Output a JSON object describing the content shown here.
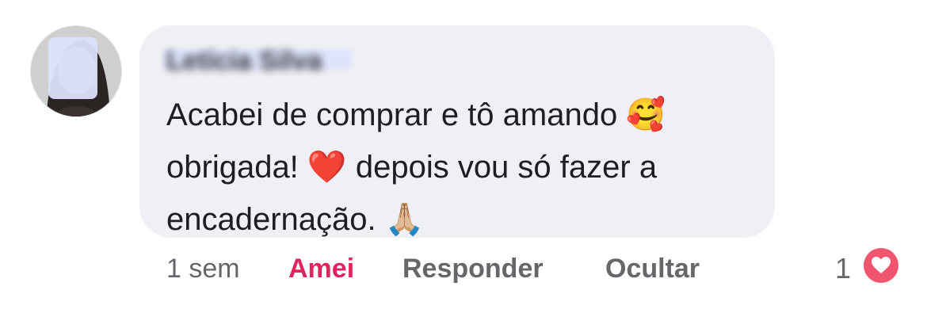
{
  "comment": {
    "author": "Letícia Silva",
    "text": "Acabei de comprar e tô amando 🥰\nobrigada! ❤️ depois vou só fazer a\nencadernação. 🙏🏼"
  },
  "actions": {
    "timestamp": "1 sem",
    "love_label": "Amei",
    "reply_label": "Responder",
    "hide_label": "Ocultar"
  },
  "reactions": {
    "count": "1",
    "icon": "heart-reaction-icon",
    "color": "#f0546e"
  },
  "colors": {
    "bubble": "#eff0f5",
    "secondary_text": "#65676b",
    "active_reaction": "#e0245e"
  }
}
